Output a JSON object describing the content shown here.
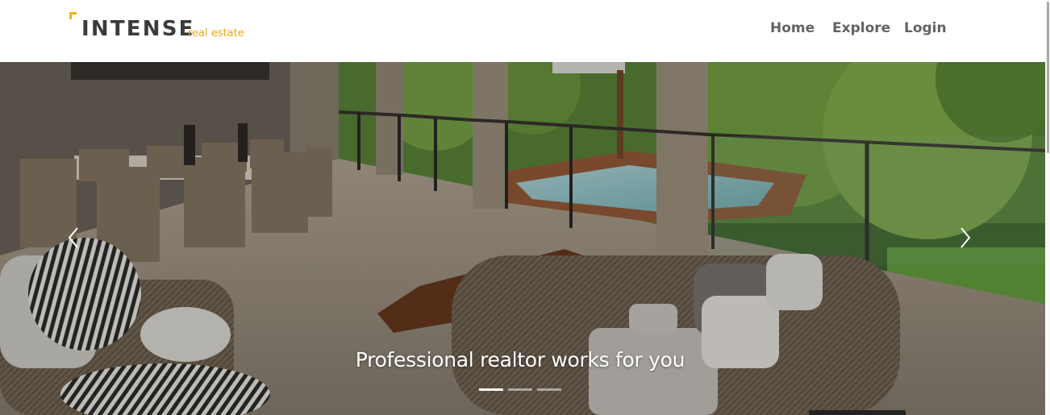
{
  "brand": {
    "name": "INTENSE",
    "tagline": "real estate",
    "accent_color": "#f2b01e"
  },
  "nav": {
    "items": [
      {
        "label": "Home"
      },
      {
        "label": "Explore"
      },
      {
        "label": "Login"
      }
    ]
  },
  "hero": {
    "caption": "Professional realtor works for you",
    "background_description_icon": "outdoor-patio-pool-photo",
    "prev_icon": "chevron-left-icon",
    "next_icon": "chevron-right-icon",
    "slide_count": 3,
    "active_slide": 1
  }
}
